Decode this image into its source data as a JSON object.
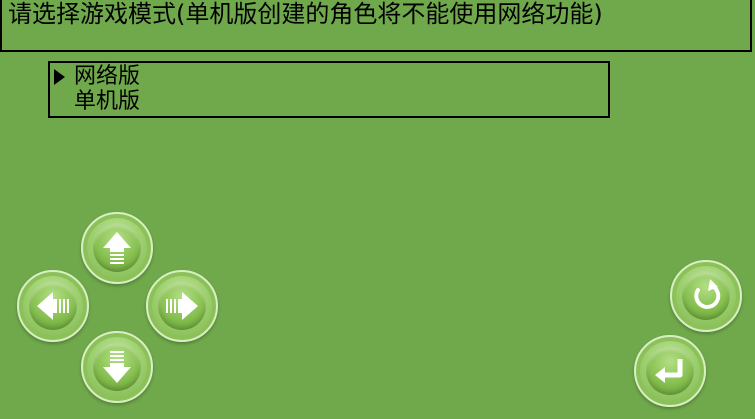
{
  "header": {
    "prompt": "请选择游戏模式(单机版创建的角色将不能使用网络功能)"
  },
  "menu": {
    "selected_index": 0,
    "items": [
      {
        "label": "网络版"
      },
      {
        "label": "单机版"
      }
    ]
  },
  "controls": {
    "dpad": [
      "arrow-up-icon",
      "arrow-left-icon",
      "arrow-right-icon",
      "arrow-down-icon"
    ],
    "actions": [
      "rotate-icon",
      "enter-icon"
    ]
  },
  "colors": {
    "background": "#6fa94b",
    "text": "#000000",
    "button_highlight": "#c6e8a4"
  }
}
